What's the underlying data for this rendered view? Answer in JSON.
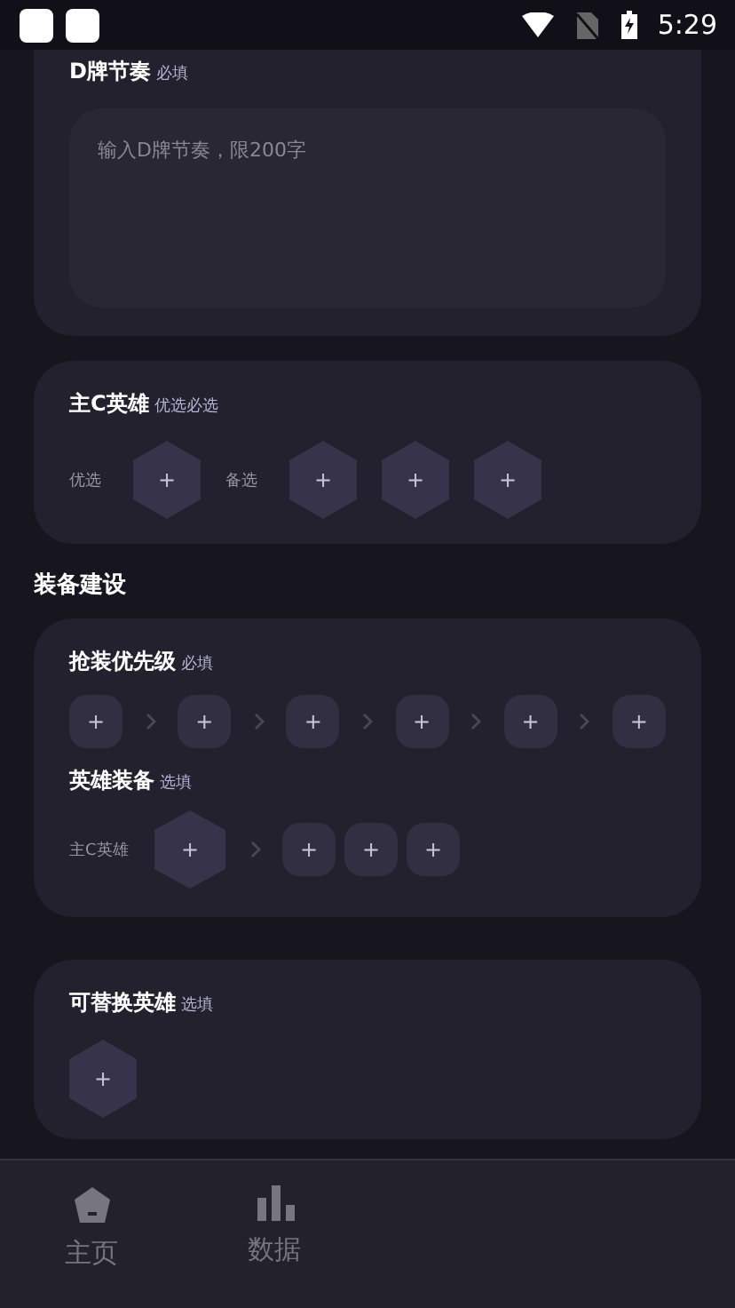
{
  "status_bar": {
    "time": "5:29"
  },
  "rhythm": {
    "title": "D牌节奏",
    "tag": "必填",
    "placeholder": "输入D牌节奏，限200字"
  },
  "main_c": {
    "title": "主C英雄",
    "tag": "优选必选",
    "groups": [
      {
        "label": "优选",
        "slots": [
          "+"
        ]
      },
      {
        "label": "备选",
        "slots": [
          "+",
          "+",
          "+"
        ]
      }
    ]
  },
  "equipment": {
    "title": "装备建设",
    "priority": {
      "title": "抢装优先级",
      "tag": "必填",
      "slots": [
        "+",
        "+",
        "+",
        "+",
        "+",
        "+"
      ]
    },
    "hero_equip": {
      "title": "英雄装备",
      "tag": "选填",
      "label": "主C英雄",
      "hero_slot": "+",
      "item_slots": [
        "+",
        "+",
        "+"
      ]
    }
  },
  "alternates": {
    "title": "可替换英雄",
    "tag": "选填",
    "slots": [
      "+"
    ]
  },
  "tabs": [
    {
      "label": "主页",
      "kind": "home"
    },
    {
      "label": "数据",
      "kind": "chart"
    }
  ]
}
